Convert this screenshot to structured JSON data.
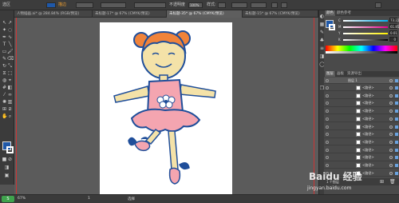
{
  "control_bar": {
    "selection_label": "选区",
    "fill_label": "描边",
    "stroke_weight": "",
    "uniform_label": "不透明度",
    "opacity_value": "100%",
    "style_label": "样式:",
    "doc_setup": "文档设置",
    "preferences": "首选项"
  },
  "tabs": [
    {
      "label": "人物插画.ai* @ 284.84% (RGB/预览)"
    },
    {
      "label": "未标题-17* @ 67% (CMYK/预览)"
    },
    {
      "label": "未标题-35* @ 67% (CMYK/预览)"
    },
    {
      "label": "未标题-15* @ 67% (CMYK/预览)"
    }
  ],
  "color_panel": {
    "tabs": [
      "颜色",
      "颜色参考"
    ],
    "channels": [
      {
        "name": "C",
        "value": "73.22",
        "color": "#1e88e5"
      },
      {
        "name": "M",
        "value": "61.85",
        "color": "#d81b60"
      },
      {
        "name": "Y",
        "value": "0.01",
        "color": "#fdd835"
      },
      {
        "name": "K",
        "value": "0",
        "color": "#212121"
      }
    ],
    "fill_color": "#1f58a8"
  },
  "layers_panel": {
    "tabs": [
      "图层",
      "画板",
      "资源导出"
    ],
    "top_layer": "图层 1",
    "rows": [
      "<路径>",
      "<路径>",
      "<路径>",
      "<路径>",
      "<路径>",
      "<路径>",
      "<路径>",
      "<路径>",
      "<路径>",
      "<路径>",
      "<路径>",
      "<路径>"
    ],
    "footer": "1 个图层"
  },
  "status_bar": {
    "zoom": "67%",
    "artboard_nav": "1",
    "tool_name": "选择"
  },
  "watermark": {
    "logo_text": "Baidu 经验",
    "url": "jingyan.baidu.com"
  }
}
